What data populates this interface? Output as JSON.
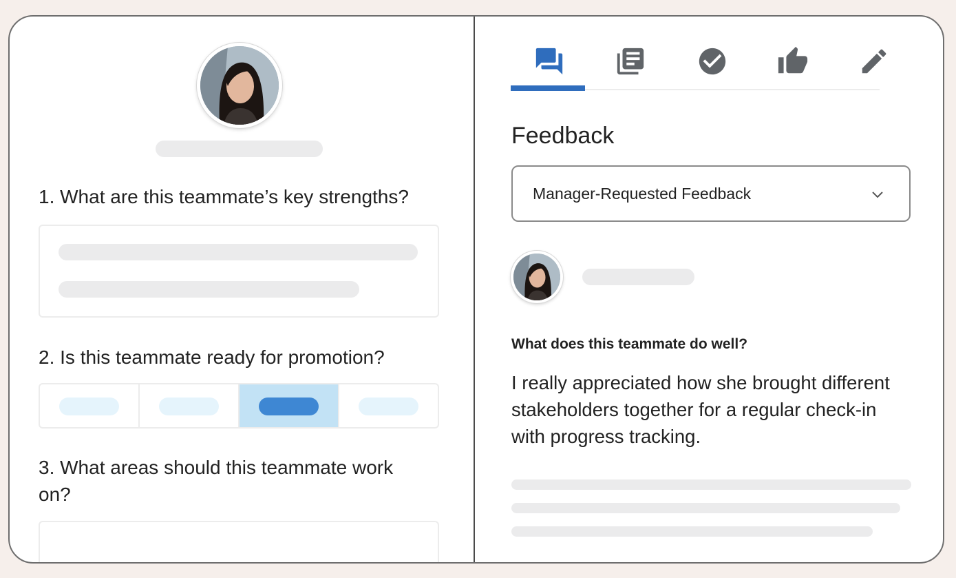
{
  "colors": {
    "background": "#f6efeb",
    "accent": "#2f6dbd",
    "selected_segment": "#3e87d3",
    "skeleton": "#ebebec"
  },
  "left_panel": {
    "questions": [
      {
        "text": "1. What are this teammate’s key strengths?"
      },
      {
        "text": "2. Is this teammate ready for promotion?"
      },
      {
        "text": "3. What areas should this teammate work on?"
      }
    ],
    "promotion_scale": {
      "option_count": 4,
      "selected_index": 2
    }
  },
  "tabs": [
    {
      "icon": "forum-icon"
    },
    {
      "icon": "document-list-icon"
    },
    {
      "icon": "check-circle-icon"
    },
    {
      "icon": "thumbs-up-icon"
    },
    {
      "icon": "pencil-icon"
    }
  ],
  "active_tab_index": 0,
  "right_panel": {
    "heading": "Feedback",
    "dropdown": {
      "selected": "Manager-Requested Feedback",
      "icon": "chevron-down-icon"
    },
    "feedback_item": {
      "question": "What does this teammate do well?",
      "answer": "I really appreciated how she brought different stakeholders together for a regular check-in with progress tracking."
    }
  }
}
